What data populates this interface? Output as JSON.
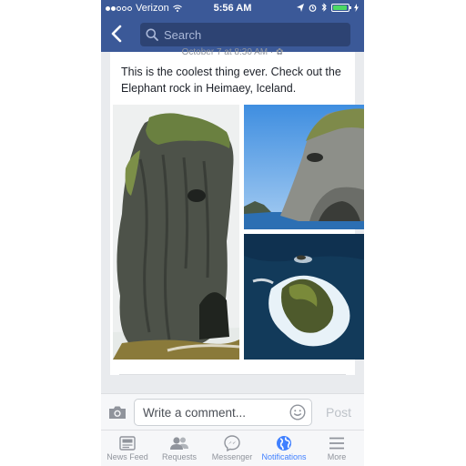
{
  "status_bar": {
    "carrier": "Verizon",
    "time": "5:56 AM",
    "battery_level": 0.95,
    "battery_color": "#4cd964"
  },
  "nav": {
    "back_icon": "chevron-left-icon",
    "search_placeholder": "Search"
  },
  "post": {
    "timestamp": "October 7 at 8:30 AM · ✿",
    "text": "This is the coolest thing ever. Check out the Elephant rock in Heimaey, Iceland."
  },
  "comment_bar": {
    "placeholder": "Write a comment...",
    "post_label": "Post"
  },
  "tabs": [
    {
      "label": "News Feed",
      "icon": "news-feed-icon",
      "active": false
    },
    {
      "label": "Requests",
      "icon": "friend-requests-icon",
      "active": false
    },
    {
      "label": "Messenger",
      "icon": "messenger-icon",
      "active": false
    },
    {
      "label": "Notifications",
      "icon": "globe-icon",
      "active": true
    },
    {
      "label": "More",
      "icon": "menu-icon",
      "active": false
    }
  ],
  "colors": {
    "brand": "#3b5998",
    "active_tab": "#4080ff",
    "inactive_tab": "#90949c"
  }
}
